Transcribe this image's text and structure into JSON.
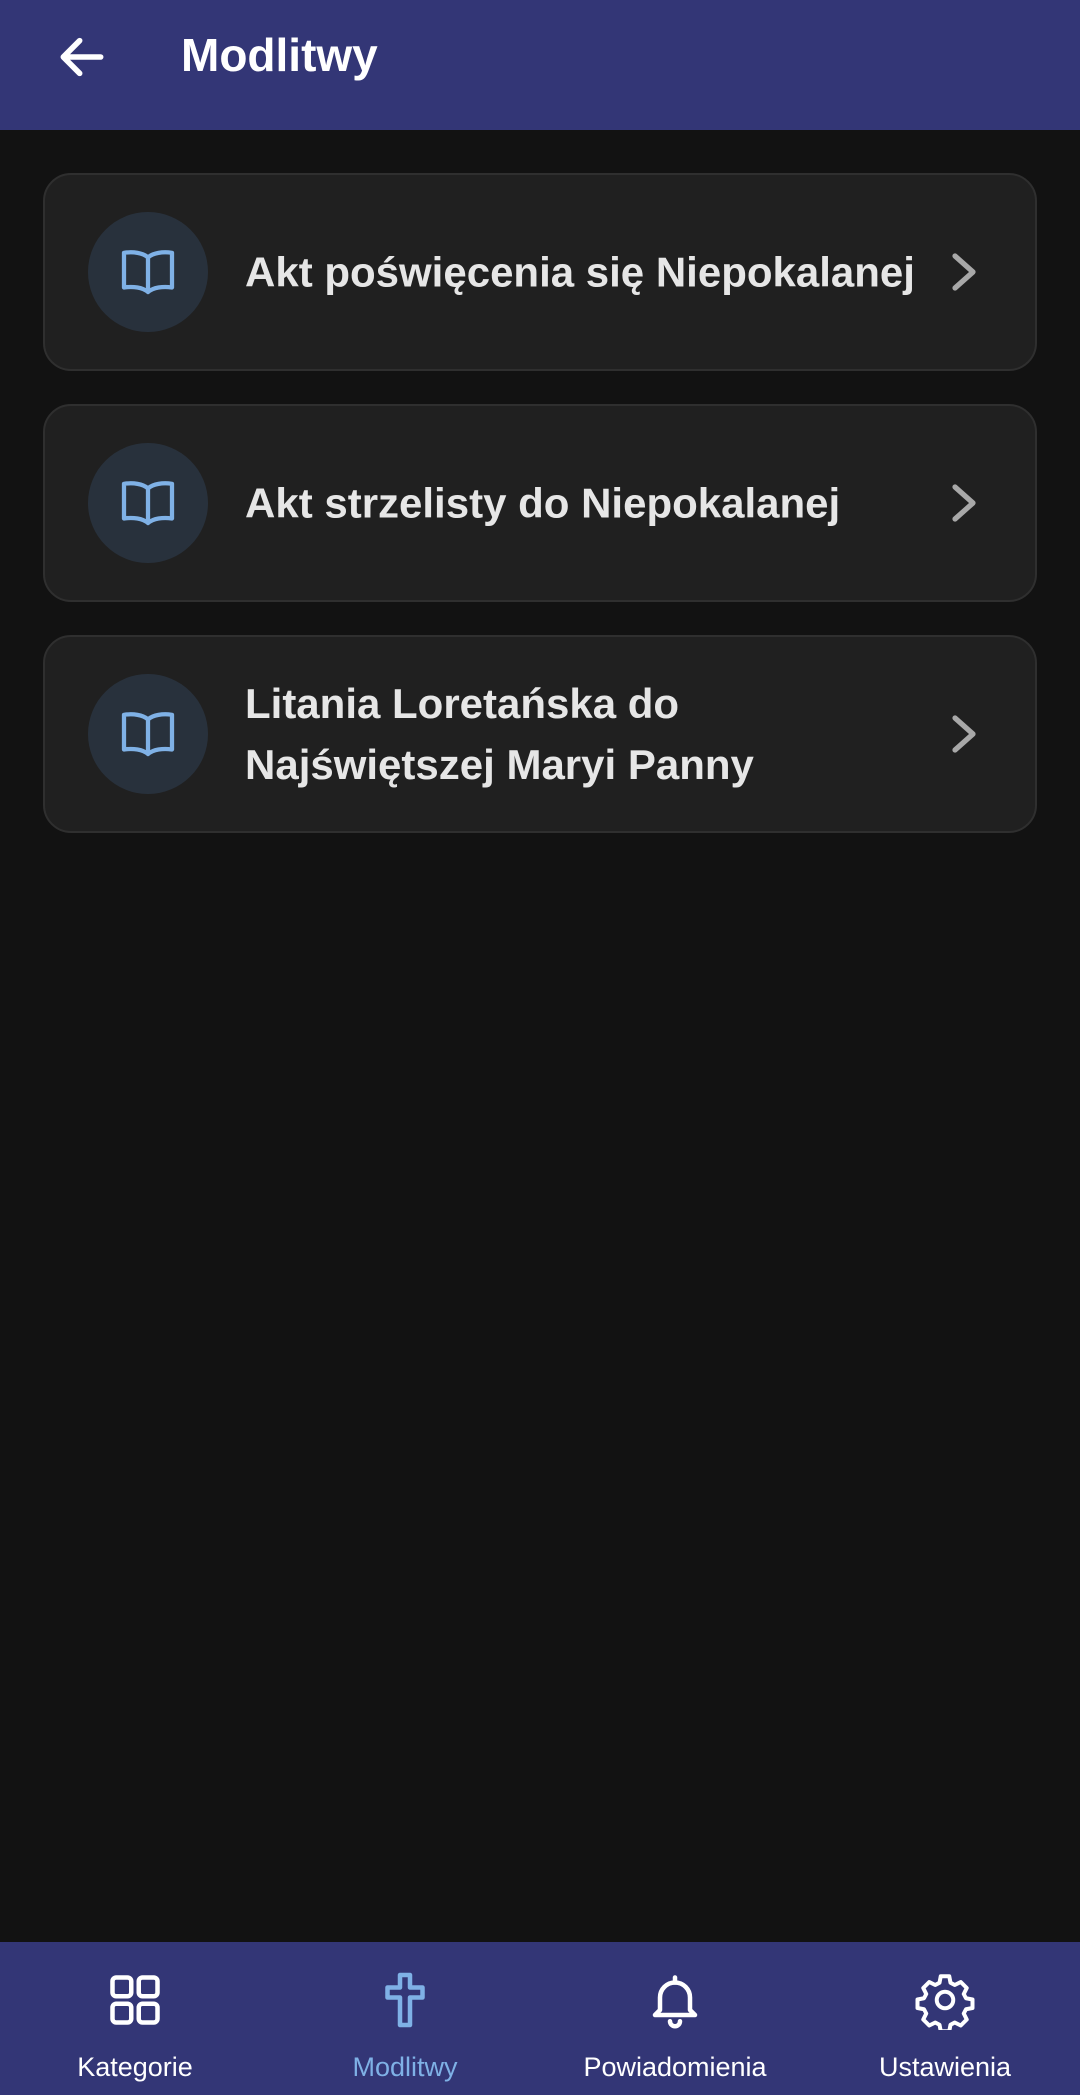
{
  "header": {
    "title": "Modlitwy"
  },
  "prayers": [
    {
      "label": "Akt poświęcenia się Niepokalanej",
      "icon": "book-open-icon"
    },
    {
      "label": "Akt strzelisty do Niepokalanej",
      "icon": "book-open-icon"
    },
    {
      "label": "Litania Loretańska do Najświętszej Maryi Panny",
      "icon": "book-open-icon"
    }
  ],
  "bottom_nav": {
    "items": [
      {
        "label": "Kategorie",
        "icon": "grid-icon",
        "active": false
      },
      {
        "label": "Modlitwy",
        "icon": "cross-icon",
        "active": true
      },
      {
        "label": "Powiadomienia",
        "icon": "bell-icon",
        "active": false
      },
      {
        "label": "Ustawienia",
        "icon": "gear-icon",
        "active": false
      }
    ]
  },
  "colors": {
    "app_bar": "#333676",
    "background": "#121212",
    "card": "#202020",
    "accent": "#7fb1e6",
    "icon_circle": "#28313c"
  }
}
